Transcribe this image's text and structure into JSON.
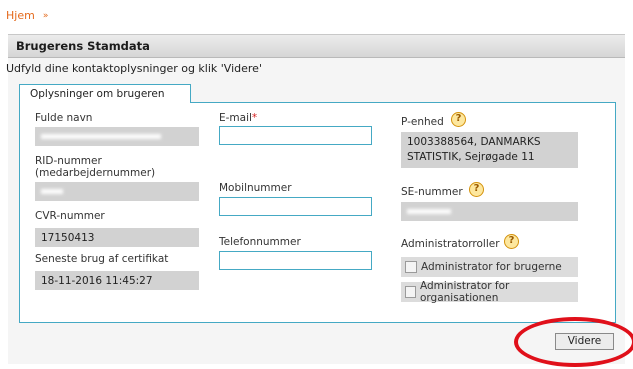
{
  "breadcrumb": {
    "home": "Hjem",
    "separator": "»"
  },
  "panel": {
    "title": "Brugerens Stamdata",
    "instruction": "Udfyld dine kontaktoplysninger og klik 'Videre'"
  },
  "tabs": [
    {
      "label": "Oplysninger om brugeren"
    }
  ],
  "fields": {
    "full_name": {
      "label": "Fulde navn"
    },
    "rid": {
      "label_line1": "RID-nummer",
      "label_line2": "(medarbejdernummer)"
    },
    "cvr": {
      "label": "CVR-nummer",
      "value": "17150413"
    },
    "last_cert": {
      "label": "Seneste brug af certifikat",
      "value": "18-11-2016 11:45:27"
    },
    "email": {
      "label": "E-mail",
      "required_mark": "*",
      "value": ""
    },
    "mobile": {
      "label": "Mobilnummer",
      "value": ""
    },
    "phone": {
      "label": "Telefonnummer",
      "value": ""
    },
    "p_unit": {
      "label": "P-enhed",
      "value_line1": "1003388564, DANMARKS",
      "value_line2": "STATISTIK, Sejrøgade 11"
    },
    "se": {
      "label": "SE-nummer"
    },
    "admin_roles": {
      "label": "Administratorroller",
      "options": [
        {
          "label": "Administrator for brugerne",
          "checked": false
        },
        {
          "label": "Administrator for organisationen",
          "checked": false
        }
      ]
    }
  },
  "icons": {
    "help": "?"
  },
  "actions": {
    "next_label": "Videre"
  },
  "colors": {
    "accent": "#45a9c4",
    "link": "#e46a1c",
    "highlight": "#e0101a",
    "help_fill": "#fde79e"
  }
}
